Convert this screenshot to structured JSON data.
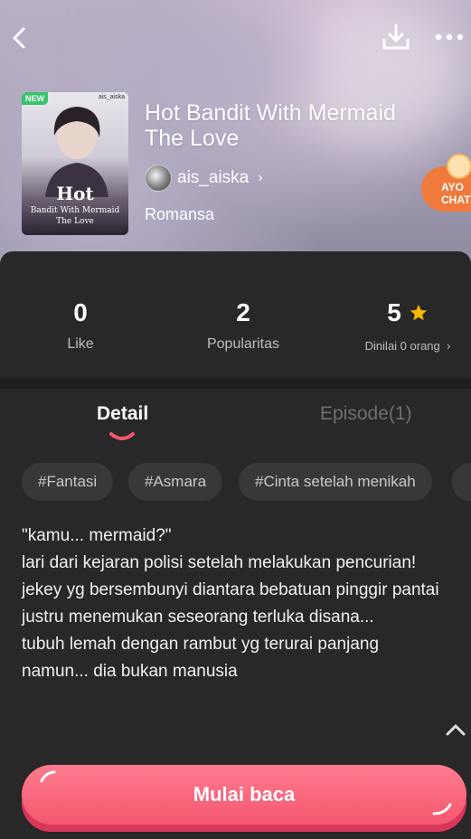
{
  "book": {
    "cover": {
      "badge": "NEW",
      "author_mark": "ais_aiska",
      "title_big": "Hot",
      "title_small_1": "Bandit With Mermaid",
      "title_small_2": "The Love"
    },
    "title": "Hot Bandit With Mermaid The Love",
    "author": "ais_aiska",
    "genre": "Romansa"
  },
  "promo": {
    "text": "AYO CHAT"
  },
  "stats": {
    "like": {
      "value": "0",
      "label": "Like"
    },
    "popularity": {
      "value": "2",
      "label": "Popularitas"
    },
    "rating": {
      "value": "5",
      "label": "Dinilai 0 orang"
    }
  },
  "tabs": {
    "detail": "Detail",
    "episode": "Episode(1)"
  },
  "tags": [
    "#Fantasi",
    "#Asmara",
    "#Cinta setelah menikah"
  ],
  "description": "\"kamu... mermaid?\"\nlari dari kejaran polisi setelah melakukan pencurian!\njekey yg bersembunyi diantara bebatuan pinggir pantai justru menemukan seseorang terluka disana...\ntubuh lemah dengan rambut yg terurai panjang namun... dia bukan manusia",
  "cta": {
    "label": "Mulai baca"
  },
  "colors": {
    "accent": "#f4586f",
    "star": "#f5b800",
    "badge": "#37c46a",
    "promo": "#f07a3c"
  },
  "icons": {
    "back": "back-arrow-icon",
    "download": "download-icon",
    "more": "more-dots-icon",
    "star": "star-icon",
    "collapse": "chevron-up-icon"
  }
}
